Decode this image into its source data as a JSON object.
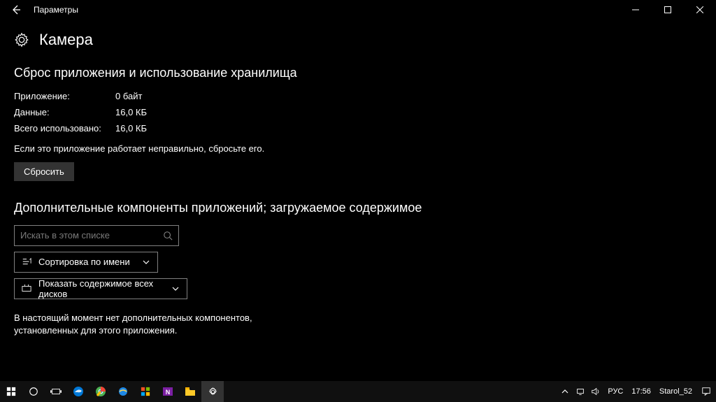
{
  "titlebar": {
    "app_name": "Параметры"
  },
  "header": {
    "page_title": "Камера"
  },
  "storage": {
    "heading": "Сброс приложения и использование хранилища",
    "rows": [
      {
        "label": "Приложение:",
        "value": "0 байт"
      },
      {
        "label": "Данные:",
        "value": "16,0 КБ"
      },
      {
        "label": "Всего использовано:",
        "value": "16,0 КБ"
      }
    ],
    "hint": "Если это приложение работает неправильно, сбросьте его.",
    "reset_label": "Сбросить"
  },
  "addons": {
    "heading": "Дополнительные компоненты приложений; загружаемое содержимое",
    "search_placeholder": "Искать в этом списке",
    "sort_label": "Сортировка по имени",
    "drives_label": "Показать содержимое всех дисков",
    "empty_line1": "В настоящий момент нет дополнительных компонентов,",
    "empty_line2": "установленных для этого приложения."
  },
  "taskbar": {
    "lang": "РУС",
    "time": "17:56",
    "user": "Starol_52"
  }
}
